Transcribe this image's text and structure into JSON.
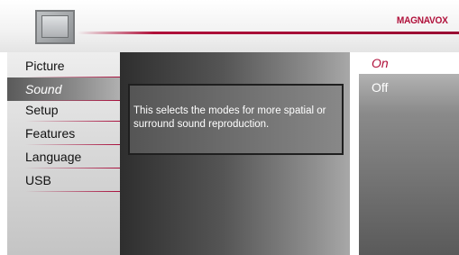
{
  "header": {
    "brand": "MAGNAVOX",
    "icon": "tv-icon",
    "accent_color": "#b0103a"
  },
  "menu": {
    "items": [
      {
        "label": "Picture",
        "selected": false
      },
      {
        "label": "Sound",
        "selected": true
      },
      {
        "label": "Setup",
        "selected": false
      },
      {
        "label": "Features",
        "selected": false
      },
      {
        "label": "Language",
        "selected": false
      },
      {
        "label": "USB",
        "selected": false
      }
    ]
  },
  "description": {
    "text": "This selects the modes for more spatial or surround sound reproduction."
  },
  "options": {
    "items": [
      {
        "label": "On",
        "selected": true
      },
      {
        "label": "Off",
        "selected": false
      }
    ]
  }
}
